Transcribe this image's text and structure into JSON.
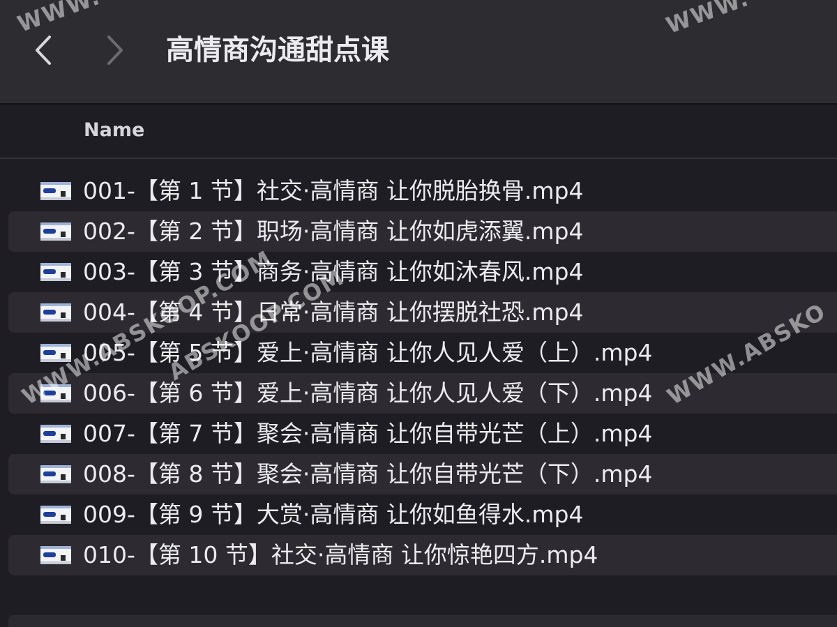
{
  "window": {
    "title": "高情商沟通甜点课"
  },
  "toolbar": {
    "back_icon": "chevron-left-icon",
    "forward_icon": "chevron-right-icon"
  },
  "list": {
    "column_name": "Name",
    "files": [
      {
        "name": "001-【第 1 节】社交·高情商 让你脱胎换骨.mp4",
        "icon": "video-file-icon"
      },
      {
        "name": "002-【第 2 节】职场·高情商 让你如虎添翼.mp4",
        "icon": "video-file-icon"
      },
      {
        "name": "003-【第 3 节】商务·高情商 让你如沐春风.mp4",
        "icon": "video-file-icon"
      },
      {
        "name": "004-【第 4 节】日常·高情商 让你摆脱社恐.mp4",
        "icon": "video-file-icon"
      },
      {
        "name": "005-【第 5 节】爱上·高情商 让你人见人爱（上）.mp4",
        "icon": "video-file-icon"
      },
      {
        "name": "006-【第 6 节】爱上·高情商 让你人见人爱（下）.mp4",
        "icon": "video-file-icon"
      },
      {
        "name": "007-【第 7 节】聚会·高情商 让你自带光芒（上）.mp4",
        "icon": "video-file-icon"
      },
      {
        "name": "008-【第 8 节】聚会·高情商 让你自带光芒（下）.mp4",
        "icon": "video-file-icon"
      },
      {
        "name": "009-【第 9 节】大赏·高情商 让你如鱼得水.mp4",
        "icon": "video-file-icon"
      },
      {
        "name": "010-【第 10 节】社交·高情商 让你惊艳四方.mp4",
        "icon": "video-file-icon"
      }
    ]
  },
  "watermarks": [
    "WWW.",
    "WWW.",
    "ABSKOOP.COM",
    "WWW.ABSKOOP.COM",
    "WWW.ABSKO"
  ],
  "colors": {
    "toolbar_bg": "#2d2c31",
    "window_bg": "#1f1d24",
    "alt_row_bg": "#2d2b31",
    "text": "#ecebef"
  }
}
